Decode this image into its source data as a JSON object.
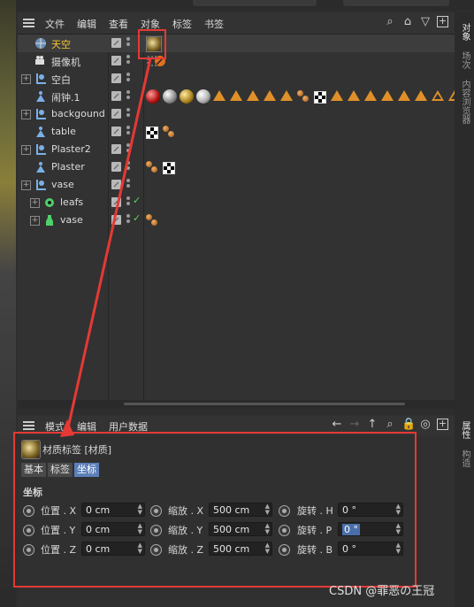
{
  "colors": {
    "accent_red": "#e53935",
    "selected_name": "#f4c430",
    "tab_active": "#5b7fb8",
    "checkmark": "#5fd35f",
    "tag_orange": "#e0902a"
  },
  "topbar": {
    "left_text": "",
    "mid_text": "",
    "right_text": ""
  },
  "object_manager": {
    "menu": [
      "文件",
      "编辑",
      "查看",
      "对象",
      "标签",
      "书签"
    ],
    "toolbar_icons": [
      "search-icon",
      "home-icon",
      "filter-icon",
      "add-panel-icon"
    ],
    "objects": [
      {
        "name": "天空",
        "icon": "sky-icon",
        "selected": true,
        "tags": [
          "material-sky"
        ]
      },
      {
        "name": "摄像机",
        "icon": "camera-icon",
        "tags": [
          "target-tag",
          "protection-tag"
        ]
      },
      {
        "name": "空白",
        "icon": "null-icon",
        "expand": true,
        "tags": []
      },
      {
        "name": "闹钟.1",
        "icon": "alarm-figure-icon",
        "tags": [
          "red-sphere",
          "grey-sphere",
          "gold-sphere",
          "chrome-sphere",
          "tri",
          "tri",
          "tri",
          "tri",
          "tri",
          "balls",
          "checker",
          "tri",
          "tri",
          "tri",
          "tri",
          "tri",
          "tri",
          "tri-hollow",
          "tri-hollow"
        ]
      },
      {
        "name": "backgound",
        "icon": "null-icon",
        "expand": true,
        "tags": []
      },
      {
        "name": "table",
        "icon": "figure-icon",
        "tags": [
          "checker",
          "balls"
        ]
      },
      {
        "name": "Plaster2",
        "icon": "null-icon",
        "expand": true,
        "tags": []
      },
      {
        "name": "Plaster",
        "icon": "figure-icon",
        "tags": [
          "balls",
          "checker"
        ]
      },
      {
        "name": "vase",
        "icon": "null-icon",
        "expand": true,
        "tags": []
      },
      {
        "name": "leafs",
        "icon": "cloner-icon",
        "indent": true,
        "tick": true,
        "tags": []
      },
      {
        "name": "vase",
        "icon": "vase-icon",
        "indent": true,
        "tick": true,
        "tags": [
          "balls"
        ]
      }
    ]
  },
  "right_tabs": [
    "对象",
    "场次",
    "内容浏览器",
    "属性",
    "构造"
  ],
  "attribute_manager": {
    "menu": [
      "模式",
      "编辑",
      "用户数据"
    ],
    "title": "材质标签 [材质]",
    "tabs": [
      "基本",
      "标签",
      "坐标"
    ],
    "section": "坐标",
    "fields": [
      {
        "label": "位置 . X",
        "value": "0 cm"
      },
      {
        "label": "缩放 . X",
        "value": "500 cm"
      },
      {
        "label": "旋转 . H",
        "value": "0 °"
      },
      {
        "label": "位置 . Y",
        "value": "0 cm"
      },
      {
        "label": "缩放 . Y",
        "value": "500 cm"
      },
      {
        "label": "旋转 . P",
        "value": "0 °"
      },
      {
        "label": "位置 . Z",
        "value": "0 cm"
      },
      {
        "label": "缩放 . Z",
        "value": "500 cm"
      },
      {
        "label": "旋转 . B",
        "value": "0 °"
      }
    ]
  },
  "watermark": "CSDN @罪恶の王冠"
}
